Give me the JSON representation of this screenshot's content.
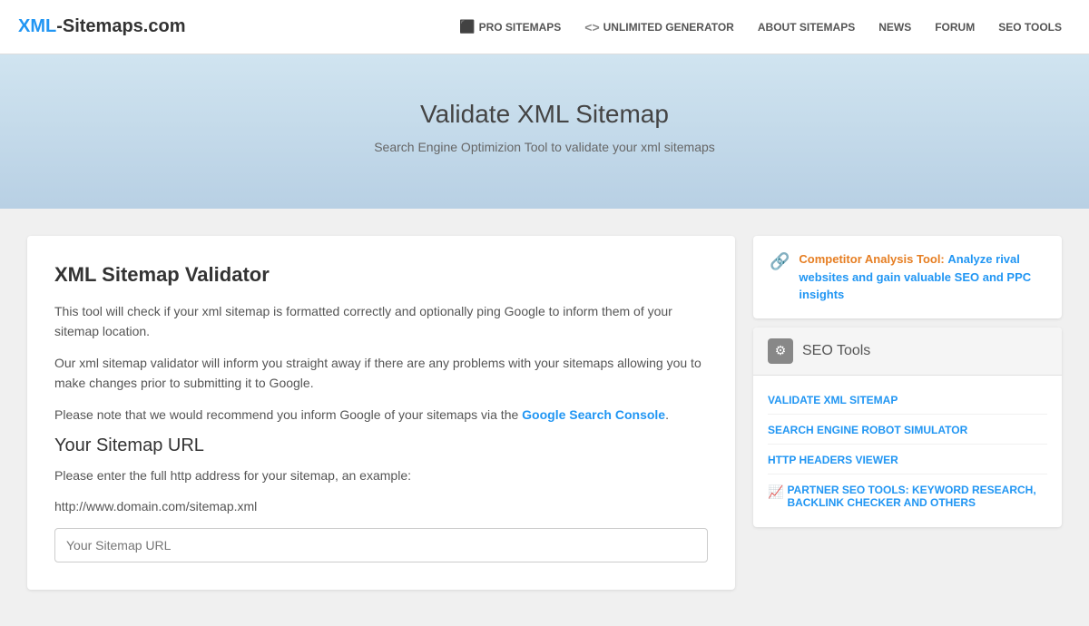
{
  "header": {
    "logo": {
      "xml_part": "XML",
      "rest": "-Sitemaps.com"
    },
    "nav": [
      {
        "id": "pro-sitemaps",
        "icon": "⬛",
        "label": "PRO SITEMAPS",
        "has_icon": true
      },
      {
        "id": "unlimited-generator",
        "icon": "<>",
        "label": "UNLIMITED GENERATOR",
        "has_icon": true
      },
      {
        "id": "about-sitemaps",
        "label": "ABOUT SITEMAPS",
        "has_icon": false
      },
      {
        "id": "news",
        "label": "NEWS",
        "has_icon": false
      },
      {
        "id": "forum",
        "label": "FORUM",
        "has_icon": false
      },
      {
        "id": "seo-tools",
        "label": "SEO TOOLS",
        "has_icon": false
      }
    ]
  },
  "hero": {
    "title": "Validate XML Sitemap",
    "subtitle": "Search Engine Optimizion Tool to validate your xml sitemaps"
  },
  "left_panel": {
    "heading": "XML Sitemap Validator",
    "paragraph1": "This tool will check if your xml sitemap is formatted correctly and optionally ping Google to inform them of your sitemap location.",
    "paragraph2": "Our xml sitemap validator will inform you straight away if there are any problems with your sitemaps allowing you to make changes prior to submitting it to Google.",
    "paragraph3_before": "Please note that we would recommend you inform Google of your sitemaps via the ",
    "paragraph3_link": "Google Search Console",
    "paragraph3_after": ".",
    "sitemap_url_heading": "Your Sitemap URL",
    "sitemap_url_desc": "Please enter the full http address for your sitemap, an example:",
    "example_url": "http://www.domain.com/sitemap.xml",
    "sitemap_url_placeholder": "Your Sitemap URL"
  },
  "right_panel": {
    "competitor_card": {
      "label": "Competitor Analysis Tool:",
      "link_text": "Analyze rival websites and gain valuable SEO and PPC insights"
    },
    "seo_tools": {
      "heading": "SEO Tools",
      "items": [
        {
          "id": "validate-xml",
          "label": "VALIDATE XML SITEMAP",
          "is_partner": false
        },
        {
          "id": "robot-simulator",
          "label": "SEARCH ENGINE ROBOT SIMULATOR",
          "is_partner": false
        },
        {
          "id": "http-headers",
          "label": "HTTP HEADERS VIEWER",
          "is_partner": false
        },
        {
          "id": "partner-seo",
          "label": "PARTNER SEO TOOLS: KEYWORD RESEARCH, BACKLINK CHECKER AND OTHERS",
          "is_partner": true
        }
      ]
    }
  }
}
